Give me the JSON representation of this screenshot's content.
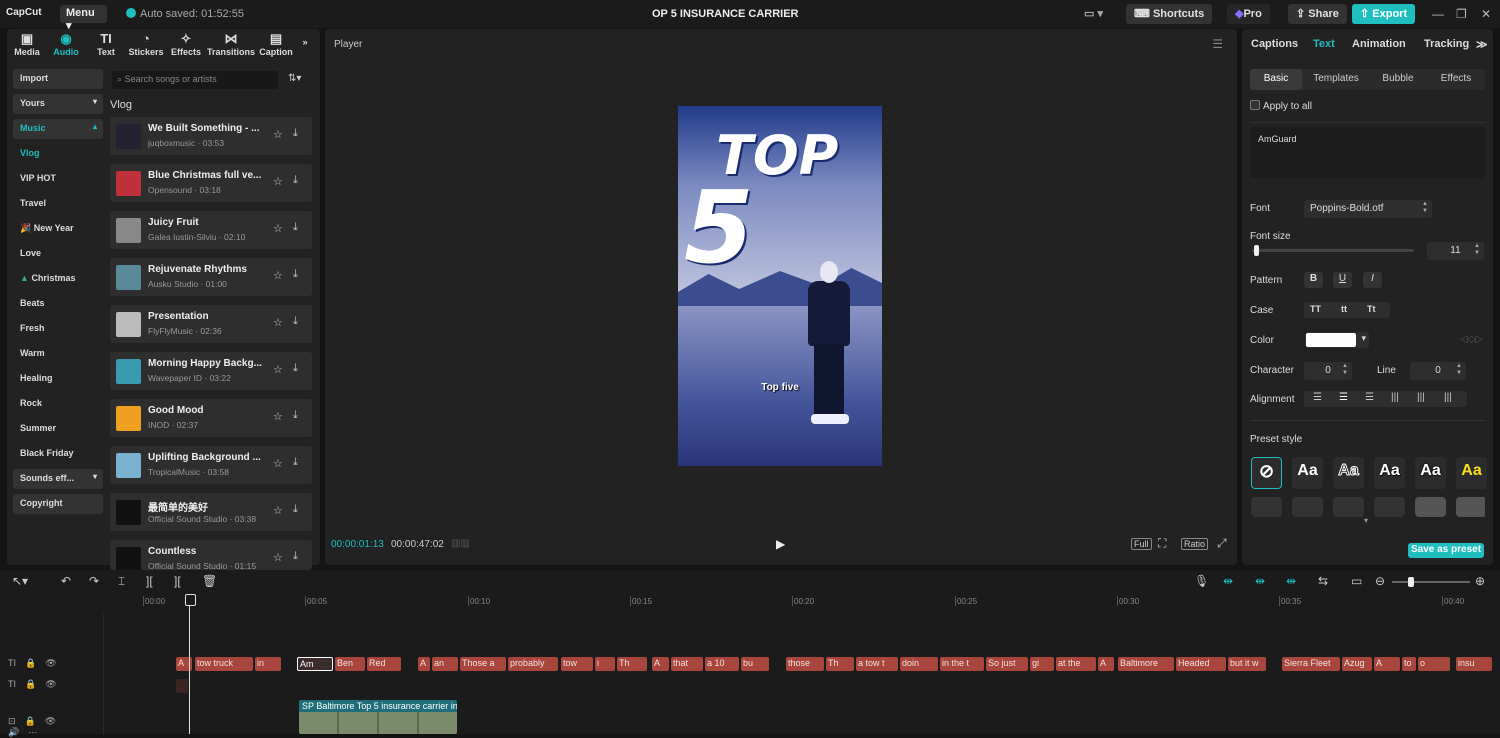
{
  "app": {
    "logo": "CapCut",
    "menu_label": "Menu",
    "autosave": "Auto saved: 01:52:55",
    "project_title": "OP 5 INSURANCE CARRIER",
    "shortcuts": "Shortcuts",
    "pro": "Pro",
    "share": "Share",
    "export": "Export",
    "accent": "#1fbfbf"
  },
  "left": {
    "tabs": [
      {
        "label": "Media",
        "icon": "media-icon"
      },
      {
        "label": "Audio",
        "icon": "audio-icon"
      },
      {
        "label": "Text",
        "icon": "text-icon"
      },
      {
        "label": "Stickers",
        "icon": "stickers-icon"
      },
      {
        "label": "Effects",
        "icon": "effects-icon"
      },
      {
        "label": "Transitions",
        "icon": "transitions-icon"
      },
      {
        "label": "Caption",
        "icon": "caption-icon"
      }
    ],
    "categories": [
      "Import",
      "Yours",
      "Music",
      "Vlog",
      "VIP HOT",
      "Travel",
      "New Year",
      "Love",
      "Christmas",
      "Beats",
      "Fresh",
      "Warm",
      "Healing",
      "Rock",
      "Summer",
      "Black Friday",
      "Sounds eff...",
      "Copyright"
    ],
    "search_placeholder": "Search songs or artists",
    "section": "Vlog",
    "songs": [
      {
        "name": "We Built Something - ...",
        "meta": "juqboxmusic · 03:53"
      },
      {
        "name": "Blue Christmas full ve...",
        "meta": "Opensound · 03:18"
      },
      {
        "name": "Juicy Fruit",
        "meta": "Galea Iustin-Silviu · 02:10"
      },
      {
        "name": "Rejuvenate Rhythms",
        "meta": "Ausku Studio · 01:00"
      },
      {
        "name": "Presentation",
        "meta": "FlyFlyMusic · 02:36"
      },
      {
        "name": "Morning Happy Backg...",
        "meta": "Wavepaper ID · 03:22"
      },
      {
        "name": "Good Mood",
        "meta": "INOD · 02:37"
      },
      {
        "name": "Uplifting Background ...",
        "meta": "TropicalMusic · 03:58"
      },
      {
        "name": "最简单的美好",
        "meta": "Official Sound Studio · 03:38"
      },
      {
        "name": "Countless",
        "meta": "Official Sound Studio · 01:15"
      }
    ]
  },
  "player": {
    "title": "Player",
    "overlay_top": "TOP",
    "overlay_num": "5",
    "caption": "Top five",
    "time_current": "00:00:01:13",
    "time_total": "00:00:47:02",
    "full": "Full",
    "ratio": "Ratio"
  },
  "right": {
    "tabs": [
      "Captions",
      "Text",
      "Animation",
      "Tracking"
    ],
    "subtabs": [
      "Basic",
      "Templates",
      "Bubble",
      "Effects"
    ],
    "apply_all": "Apply to all",
    "text_value": "AmGuard",
    "font_label": "Font",
    "font_value": "Poppins-Bold.otf",
    "font_size_label": "Font size",
    "font_size_value": "11",
    "pattern_label": "Pattern",
    "pattern": [
      "B",
      "U",
      "I"
    ],
    "case_label": "Case",
    "case": [
      "TT",
      "tt",
      "Tt"
    ],
    "color_label": "Color",
    "character_label": "Character",
    "character_value": "0",
    "line_label": "Line",
    "line_value": "0",
    "alignment_label": "Alignment",
    "preset_label": "Preset style",
    "preset_sample": "Aa",
    "save_preset": "Save as preset"
  },
  "timeline": {
    "ticks": [
      "00:00",
      "00:05",
      "00:10",
      "00:15",
      "00:20",
      "00:25",
      "00:30",
      "00:35",
      "00:40"
    ],
    "clips": [
      "A",
      "tow truck",
      "in",
      "Am",
      "Ben",
      "Red",
      "A",
      "an",
      "Those a",
      "probably",
      "tow",
      "i",
      "Th",
      "A",
      "that",
      "a 10",
      "bu",
      "those",
      "Th",
      "a tow t",
      "doin",
      "in the t",
      "So just",
      "gi",
      "at the",
      "A",
      "Baltimore",
      "Headed",
      "but it w",
      "Sierra Fleet",
      "Azug",
      "A",
      "to",
      "o",
      "insu"
    ],
    "video_clip": "SP Baltimore Top 5 insurance carrier in"
  }
}
